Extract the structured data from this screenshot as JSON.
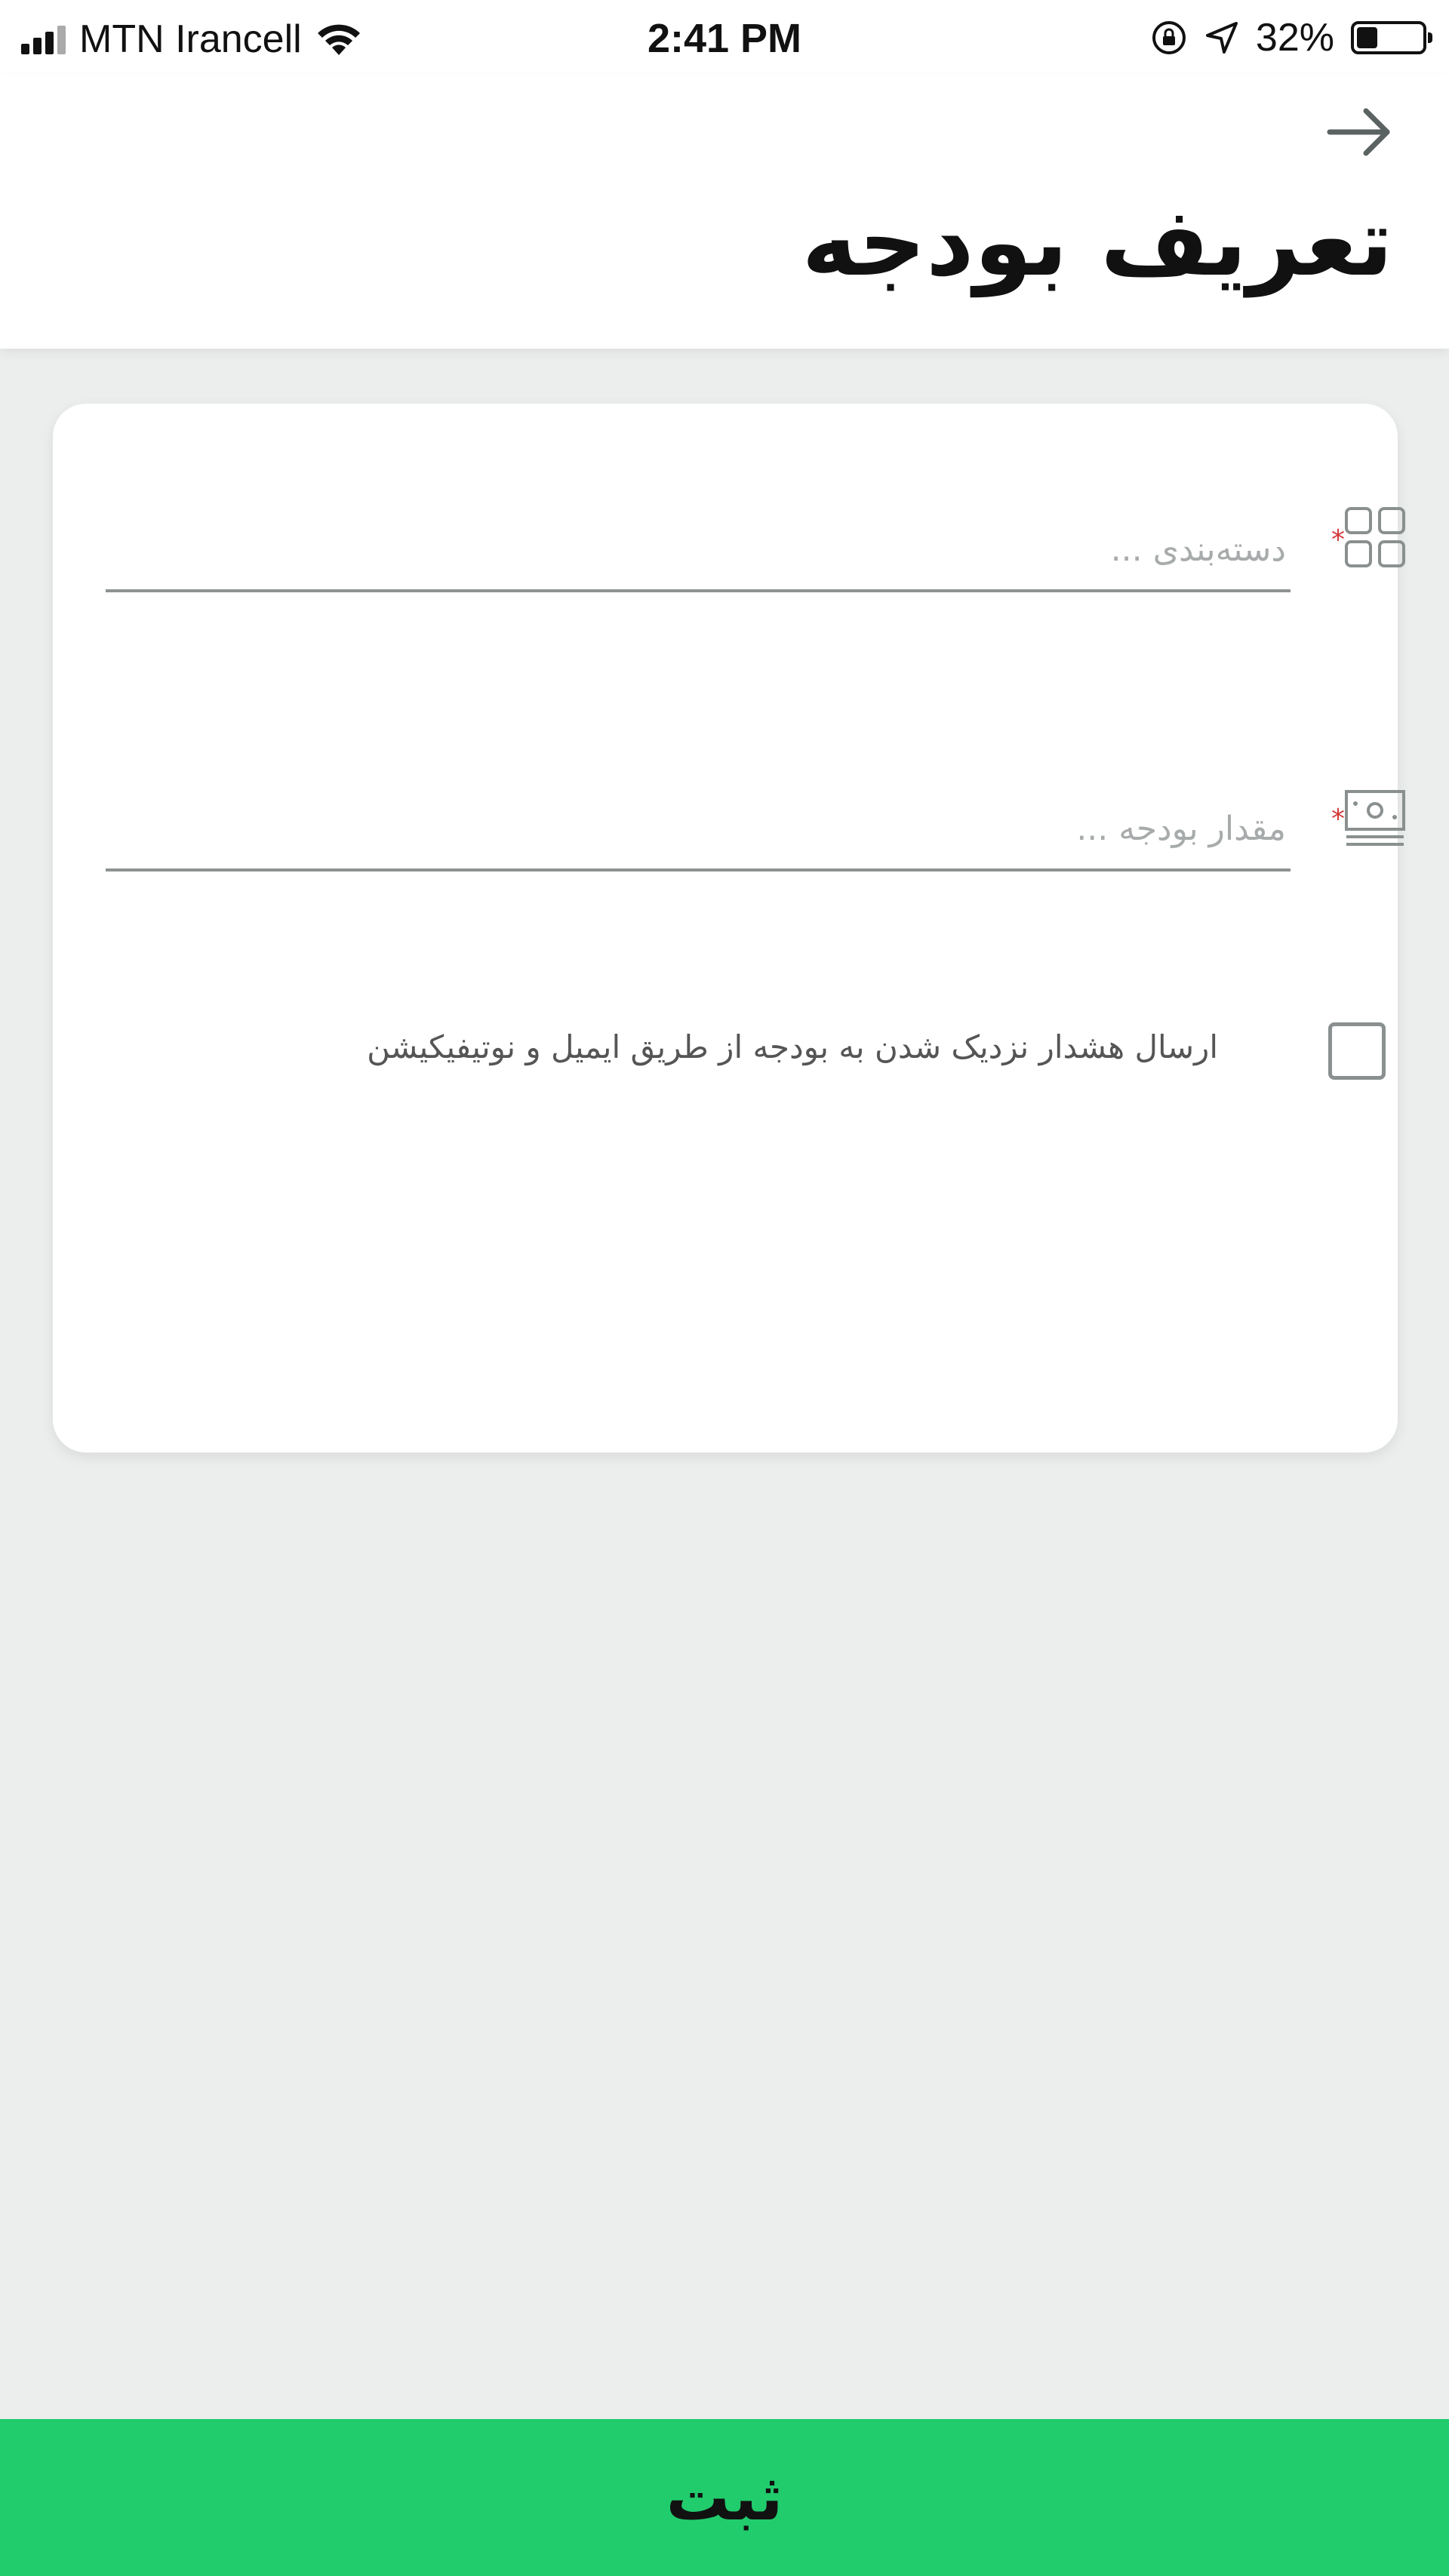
{
  "status_bar": {
    "carrier": "MTN Irancell",
    "time": "2:41 PM",
    "battery_percent": "32%",
    "battery_level": 0.32,
    "icons": [
      "signal-icon",
      "wifi-icon",
      "orientation-lock-icon",
      "location-icon",
      "battery-icon"
    ]
  },
  "header": {
    "back_icon": "arrow-right-icon",
    "title": "تعریف بودجه"
  },
  "form": {
    "category": {
      "icon": "grid-icon",
      "required_mark": "*",
      "placeholder": "دسته‌بندی ...",
      "value": ""
    },
    "amount": {
      "icon": "money-icon",
      "required_mark": "*",
      "placeholder": "مقدار بودجه ...",
      "value": ""
    },
    "alert": {
      "checked": false,
      "label": "ارسال هشدار نزدیک شدن به بودجه از طریق ایمیل و نوتیفیکیشن"
    }
  },
  "submit": {
    "label": "ثبت"
  },
  "colors": {
    "primary": "#21cc6d",
    "background": "#eceeed",
    "required": "#d33a3a"
  }
}
